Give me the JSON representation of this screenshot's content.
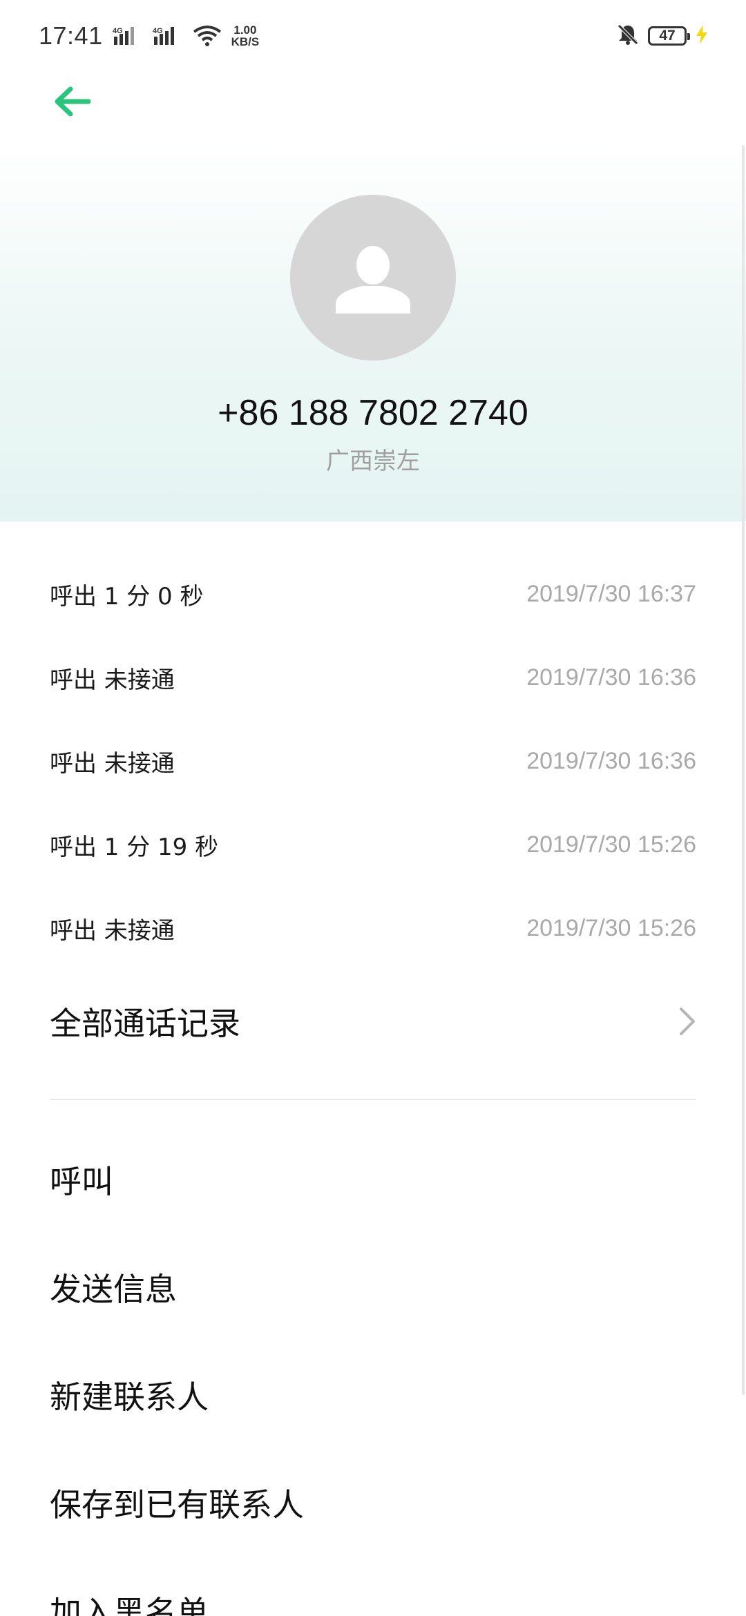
{
  "status_bar": {
    "time": "17:41",
    "network_1": "4G",
    "network_2": "4G",
    "speed_value": "1.00",
    "speed_unit": "KB/S",
    "battery": "47"
  },
  "contact": {
    "phone_number": "+86 188 7802 2740",
    "location": "广西崇左"
  },
  "call_log": [
    {
      "type": "呼出  1 分 0 秒",
      "time": "2019/7/30 16:37"
    },
    {
      "type": "呼出 未接通",
      "time": "2019/7/30 16:36"
    },
    {
      "type": "呼出 未接通",
      "time": "2019/7/30 16:36"
    },
    {
      "type": "呼出  1 分 19 秒",
      "time": "2019/7/30 15:26"
    },
    {
      "type": "呼出 未接通",
      "time": "2019/7/30 15:26"
    }
  ],
  "all_calls_label": "全部通话记录",
  "actions": [
    "呼叫",
    "发送信息",
    "新建联系人",
    "保存到已有联系人",
    "加入黑名单"
  ],
  "colors": {
    "accent": "#2bc47d",
    "secondary_text": "#a9a9a9",
    "avatar_bg": "#d6d6d6"
  }
}
